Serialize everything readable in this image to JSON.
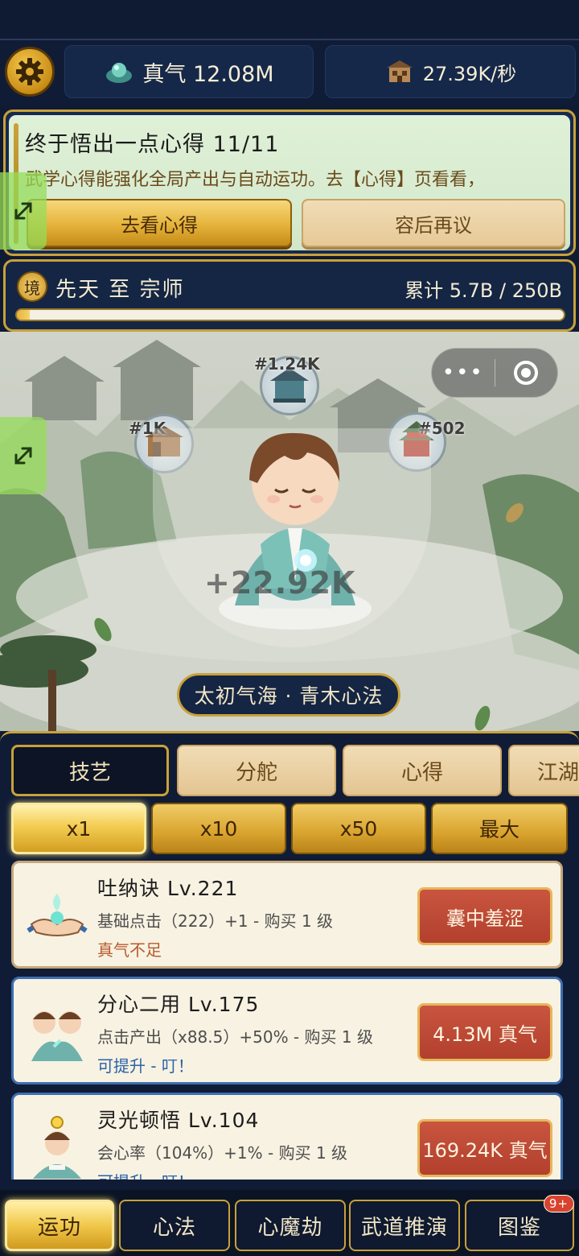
{
  "topbar": {
    "settings_icon": "gear-icon",
    "qi_label": "真气 12.08M",
    "rate_label": "27.39K/秒"
  },
  "quest": {
    "title": "终于悟出一点心得  11/11",
    "description": "武学心得能强化全局产出与自动运功。去【心得】页看看，",
    "go_button": "去看心得",
    "later_button": "容后再议"
  },
  "realm": {
    "badge": "境",
    "label": "先天 至 宗师",
    "total": "累计 5.7B / 250B",
    "progress": 0.0228
  },
  "scene": {
    "capsule_more": "•••",
    "nodes": [
      {
        "label": "#1.24K"
      },
      {
        "label": "#1K"
      },
      {
        "label": "#502"
      }
    ],
    "gain": "+22.92K",
    "technique": "太初气海 · 青木心法"
  },
  "tabs": [
    {
      "label": "技艺",
      "active": true
    },
    {
      "label": "分舵",
      "active": false
    },
    {
      "label": "心得",
      "active": false
    },
    {
      "label": "江湖",
      "active": false
    }
  ],
  "multipliers": [
    {
      "label": "x1",
      "active": true
    },
    {
      "label": "x10",
      "active": false
    },
    {
      "label": "x50",
      "active": false
    },
    {
      "label": "最大",
      "active": false
    }
  ],
  "skills": [
    {
      "name": "吐纳诀  Lv.221",
      "desc": "基础点击（222）+1 - 购买 1 级",
      "status": "真气不足",
      "button": "囊中羞涩"
    },
    {
      "name": "分心二用  Lv.175",
      "desc": "点击产出（x88.5）+50% - 购买 1 级",
      "status": "可提升 - 叮！",
      "button": "4.13M 真气"
    },
    {
      "name": "灵光顿悟  Lv.104",
      "desc": "会心率（104%）+1% - 购买 1 级",
      "status": "可提升 - 叮！",
      "button": "169.24K 真气"
    }
  ],
  "nav": [
    {
      "label": "运功",
      "active": true
    },
    {
      "label": "心法",
      "active": false
    },
    {
      "label": "心魔劫",
      "active": false
    },
    {
      "label": "武道推演",
      "active": false
    },
    {
      "label": "图鉴",
      "active": false,
      "badge": "9+"
    }
  ],
  "colors": {
    "navy": "#101c36",
    "gold": "#c9a13a",
    "cream": "#f8f2e2",
    "buy_red": "#b2402d"
  }
}
